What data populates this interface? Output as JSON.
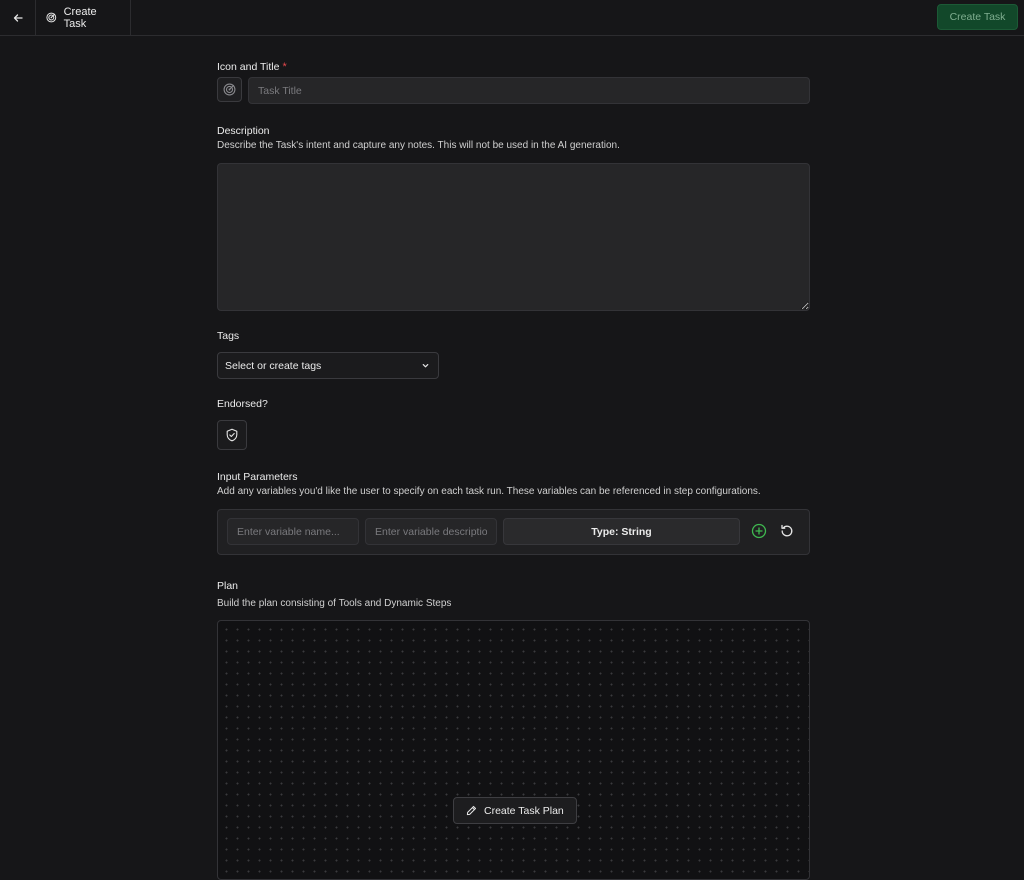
{
  "header": {
    "title": "Create Task",
    "create_button_label": "Create Task",
    "back_icon": "arrow-left-icon",
    "task_icon": "target-icon"
  },
  "form": {
    "icon_title": {
      "label": "Icon and Title",
      "required_mark": "*",
      "placeholder": "Task Title",
      "value": ""
    },
    "description": {
      "label": "Description",
      "help": "Describe the Task's intent and capture any notes. This will not be used in the AI generation.",
      "value": ""
    },
    "tags": {
      "label": "Tags",
      "placeholder": "Select or create tags"
    },
    "endorsed": {
      "label": "Endorsed?",
      "icon": "shield-check-icon"
    },
    "input_parameters": {
      "label": "Input Parameters",
      "help": "Add any variables you'd like the user to specify on each task run. These variables can be referenced in step configurations.",
      "name_placeholder": "Enter variable name...",
      "description_placeholder": "Enter variable description",
      "type_label": "Type: String"
    },
    "plan": {
      "label": "Plan",
      "help": "Build the plan consisting of Tools and Dynamic Steps",
      "create_plan_label": "Create Task Plan"
    }
  },
  "colors": {
    "background": "#161618",
    "accent_green": "#12482a",
    "add_icon_green": "#3fb950",
    "required_red": "#e5484d"
  }
}
